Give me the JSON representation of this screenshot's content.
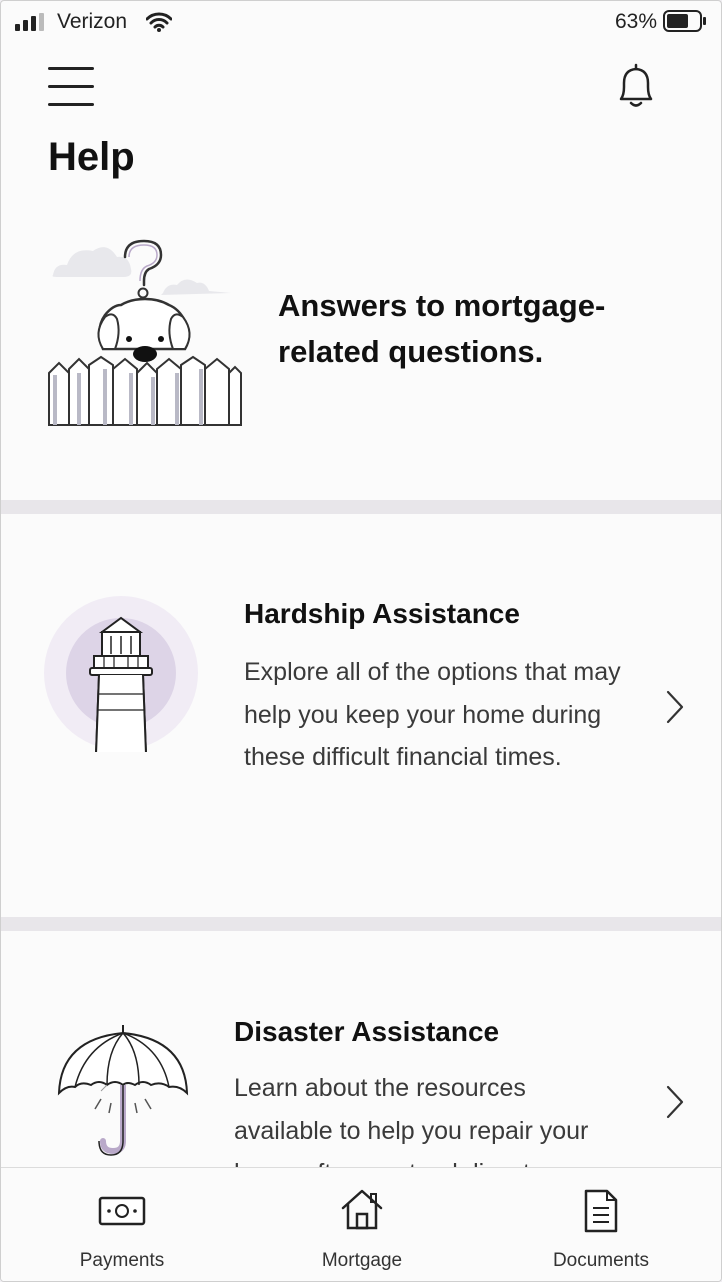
{
  "status_bar": {
    "carrier": "Verizon",
    "battery_pct": "63%"
  },
  "header": {
    "title": "Help"
  },
  "hero": {
    "heading": "Answers to mortgage-related questions."
  },
  "cards": [
    {
      "title": "Hardship Assistance",
      "description": "Explore all of the options that may help you keep your home during these difficult financial times.",
      "icon": "lighthouse-icon"
    },
    {
      "title": "Disaster Assistance",
      "description": "Learn about the resources available to help you repair your home after a natural disaster.",
      "icon": "umbrella-icon"
    }
  ],
  "tabbar": {
    "items": [
      {
        "label": "Payments",
        "icon": "money-icon"
      },
      {
        "label": "Mortgage",
        "icon": "house-icon"
      },
      {
        "label": "Documents",
        "icon": "document-icon"
      }
    ]
  },
  "colors": {
    "accent": "#b9a9c9",
    "accent_light": "#f1ecf5",
    "text": "#111111"
  }
}
